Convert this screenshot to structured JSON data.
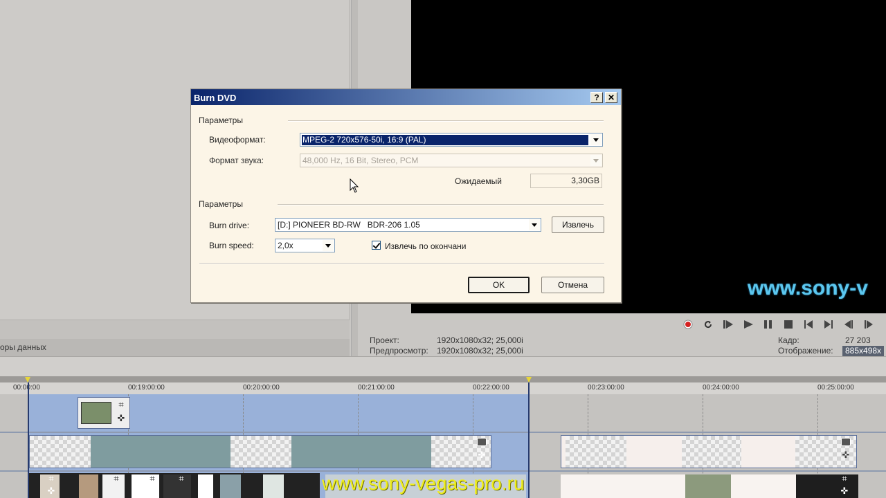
{
  "app": {
    "left_tab_label": "оры данных",
    "preview_watermark": "www.sony-v",
    "transport": [
      "record-icon",
      "loop-icon",
      "play-from-start-icon",
      "play-icon",
      "pause-icon",
      "stop-icon",
      "prev-marker-icon",
      "next-marker-icon",
      "prev-frame-icon",
      "next-frame-icon"
    ],
    "info": {
      "project_label": "Проект:",
      "project_value": "1920x1080x32; 25,000i",
      "preview_label": "Предпросмотр:",
      "preview_value": "1920x1080x32; 25,000i",
      "frame_label": "Кадр:",
      "frame_value": "27 203",
      "display_label": "Отображение:",
      "display_value": "885x498x"
    }
  },
  "timeline": {
    "ticks": [
      "00:18:00:00",
      "00:19:00:00",
      "00:20:00:00",
      "00:21:00:00",
      "00:22:00:00",
      "00:23:00:00",
      "00:24:00:00",
      "00:25:00:00"
    ],
    "tick_shown": [
      "00:00:00",
      "00:19:00:00",
      "00:20:00:00",
      "00:21:00:00",
      "00:22:00:00",
      "00:23:00:00",
      "00:24:00:00",
      "00:25:00:00"
    ],
    "watermark": "www.sony-vegas-pro.ru",
    "selection_color": "#89abe2"
  },
  "dialog": {
    "title": "Burn DVD",
    "help_label": "?",
    "close_label": "✕",
    "section1_label": "Параметры",
    "video_format_label": "Видеоформат:",
    "video_format_value": "MPEG-2 720x576-50i, 16:9 (PAL)",
    "audio_format_label": "Формат звука:",
    "audio_format_value": "48,000 Hz, 16 Bit, Stereo, PCM",
    "expected_label": "Ожидаемый",
    "expected_value": "3,30GB",
    "section2_label": "Параметры",
    "burn_drive_label": "Burn drive:",
    "burn_drive_value": "[D:] PIONEER BD-RW   BDR-206 1.05",
    "eject_label": "Извлечь",
    "burn_speed_label": "Burn speed:",
    "burn_speed_value": "2,0x",
    "eject_after_label": "Извлечь по окончани",
    "eject_after_checked": true,
    "ok_label": "OK",
    "cancel_label": "Отмена"
  }
}
